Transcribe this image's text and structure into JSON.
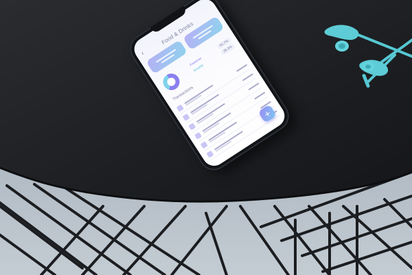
{
  "photo": {
    "description_free": true,
    "colors": {
      "table": "#1f2124",
      "floor": "#a9b4bf",
      "earphones": "#56c7d2",
      "phone_body": "#111317",
      "accent_purple": "#8b7ff0",
      "accent_cyan": "#7fd3ea"
    }
  },
  "app": {
    "title": "Food & Drinks",
    "back_icon": "chevron-left-icon",
    "cards": [
      {
        "name": "card-left"
      },
      {
        "name": "card-right"
      }
    ],
    "summary": {
      "expense_label": "Expense",
      "expense_value": "63.7%",
      "income_label": "Income",
      "income_value": "36.3%",
      "expense_fraction": 0.637
    },
    "section_title": "Transactions",
    "rows": 8,
    "fab_label": "+"
  }
}
